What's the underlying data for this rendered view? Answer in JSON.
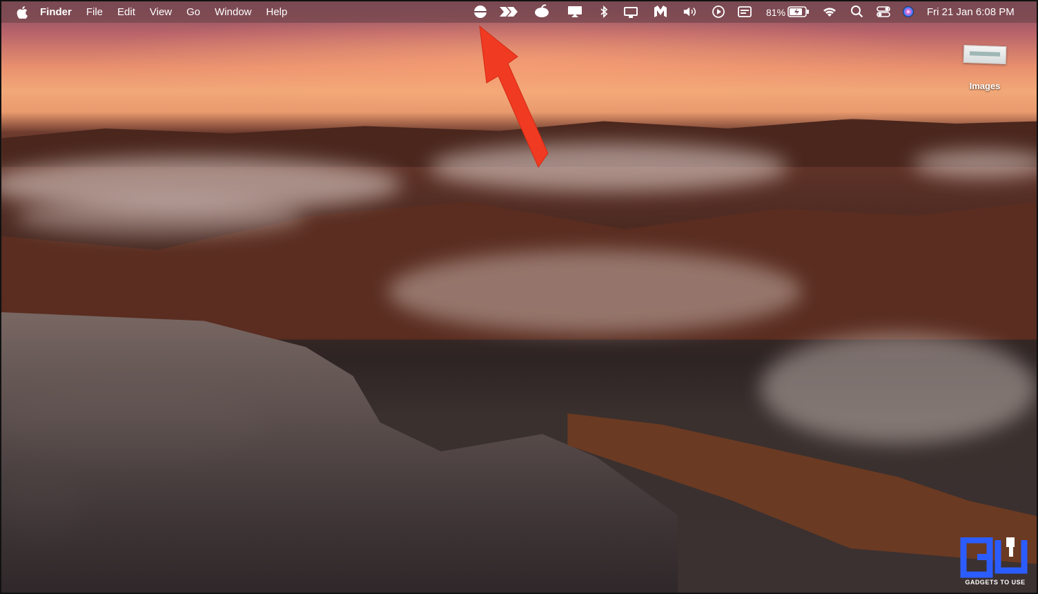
{
  "menubar": {
    "app_name": "Finder",
    "menus": [
      "File",
      "Edit",
      "View",
      "Go",
      "Window",
      "Help"
    ],
    "status": {
      "battery_percent": "81%",
      "datetime": "Fri 21 Jan  6:08 PM"
    },
    "status_icons": [
      "menubar-app-icon-highlighted",
      "fast-forward-icon",
      "coconut-battery-icon",
      "airplay-display-icon",
      "bluetooth-icon",
      "display-icon",
      "malwarebytes-icon",
      "volume-icon",
      "play-icon",
      "keyboard-input-icon",
      "battery-icon",
      "wifi-icon",
      "search-icon",
      "control-center-icon",
      "siri-icon"
    ]
  },
  "desktop": {
    "icons": [
      {
        "label": "Images",
        "icon": "image-file-icon"
      }
    ]
  },
  "annotation": {
    "shape": "arrow",
    "color": "#f03a22"
  },
  "watermark": {
    "text": "GADGETS TO USE",
    "color": "#2b5cff"
  }
}
